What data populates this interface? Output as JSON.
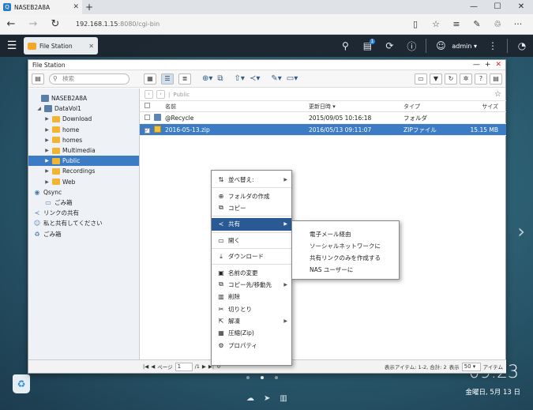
{
  "browser": {
    "tab_title": "NASEB2A8A",
    "tab_icon": "Q",
    "url_host": "192.168.1.15",
    "url_rest": ":8080/cgi-bin"
  },
  "qts": {
    "app_tab": "File Station",
    "notification_count": "1",
    "user": "admin",
    "time": "09:23",
    "date": "金曜日, 5月 13 日"
  },
  "fs": {
    "window_title": "File Station",
    "search_placeholder": "検索",
    "path": "Public",
    "tree": [
      {
        "label": "NASEB2A8A"
      },
      {
        "label": "DataVol1"
      },
      {
        "label": "Download"
      },
      {
        "label": "home"
      },
      {
        "label": "homes"
      },
      {
        "label": "Multimedia"
      },
      {
        "label": "Public"
      },
      {
        "label": "Recordings"
      },
      {
        "label": "Web"
      },
      {
        "label": "Qsync"
      },
      {
        "label": "ごみ箱"
      },
      {
        "label": "リンクの共有"
      },
      {
        "label": "私と共有してください"
      },
      {
        "label": "ごみ箱"
      }
    ],
    "columns": {
      "name": "名前",
      "modified": "更新日時",
      "type": "タイプ",
      "size": "サイズ"
    },
    "rows": [
      {
        "name": "@Recycle",
        "modified": "2015/09/05 10:16:18",
        "type": "フォルダ",
        "size": ""
      },
      {
        "name": "2016-05-13.zip",
        "modified": "2016/05/13 09:11:07",
        "type": "ZIPファイル",
        "size": "15.15 MB"
      }
    ],
    "status": {
      "page_label": "ページ",
      "page_value": "1",
      "page_total": "/1",
      "items_label": "表示アイテム: 1-2, 合計: 2",
      "show_label": "表示",
      "show_value": "50",
      "items_unit": "アイテム"
    }
  },
  "context_menu": {
    "items": [
      {
        "label": "並べ替え:"
      },
      {
        "label": "フォルダの作成"
      },
      {
        "label": "コピー"
      },
      {
        "label": "共有"
      },
      {
        "label": "開く"
      },
      {
        "label": "ダウンロード"
      },
      {
        "label": "名前の変更"
      },
      {
        "label": "コピー先/移動先"
      },
      {
        "label": "削除"
      },
      {
        "label": "切りとり"
      },
      {
        "label": "解凍"
      },
      {
        "label": "圧縮(Zip)"
      },
      {
        "label": "プロパティ"
      }
    ],
    "share_submenu": [
      {
        "label": "電子メール経由"
      },
      {
        "label": "ソーシャルネットワークに"
      },
      {
        "label": "共有リンクのみを作成する"
      },
      {
        "label": "NAS ユーザーに"
      }
    ]
  }
}
